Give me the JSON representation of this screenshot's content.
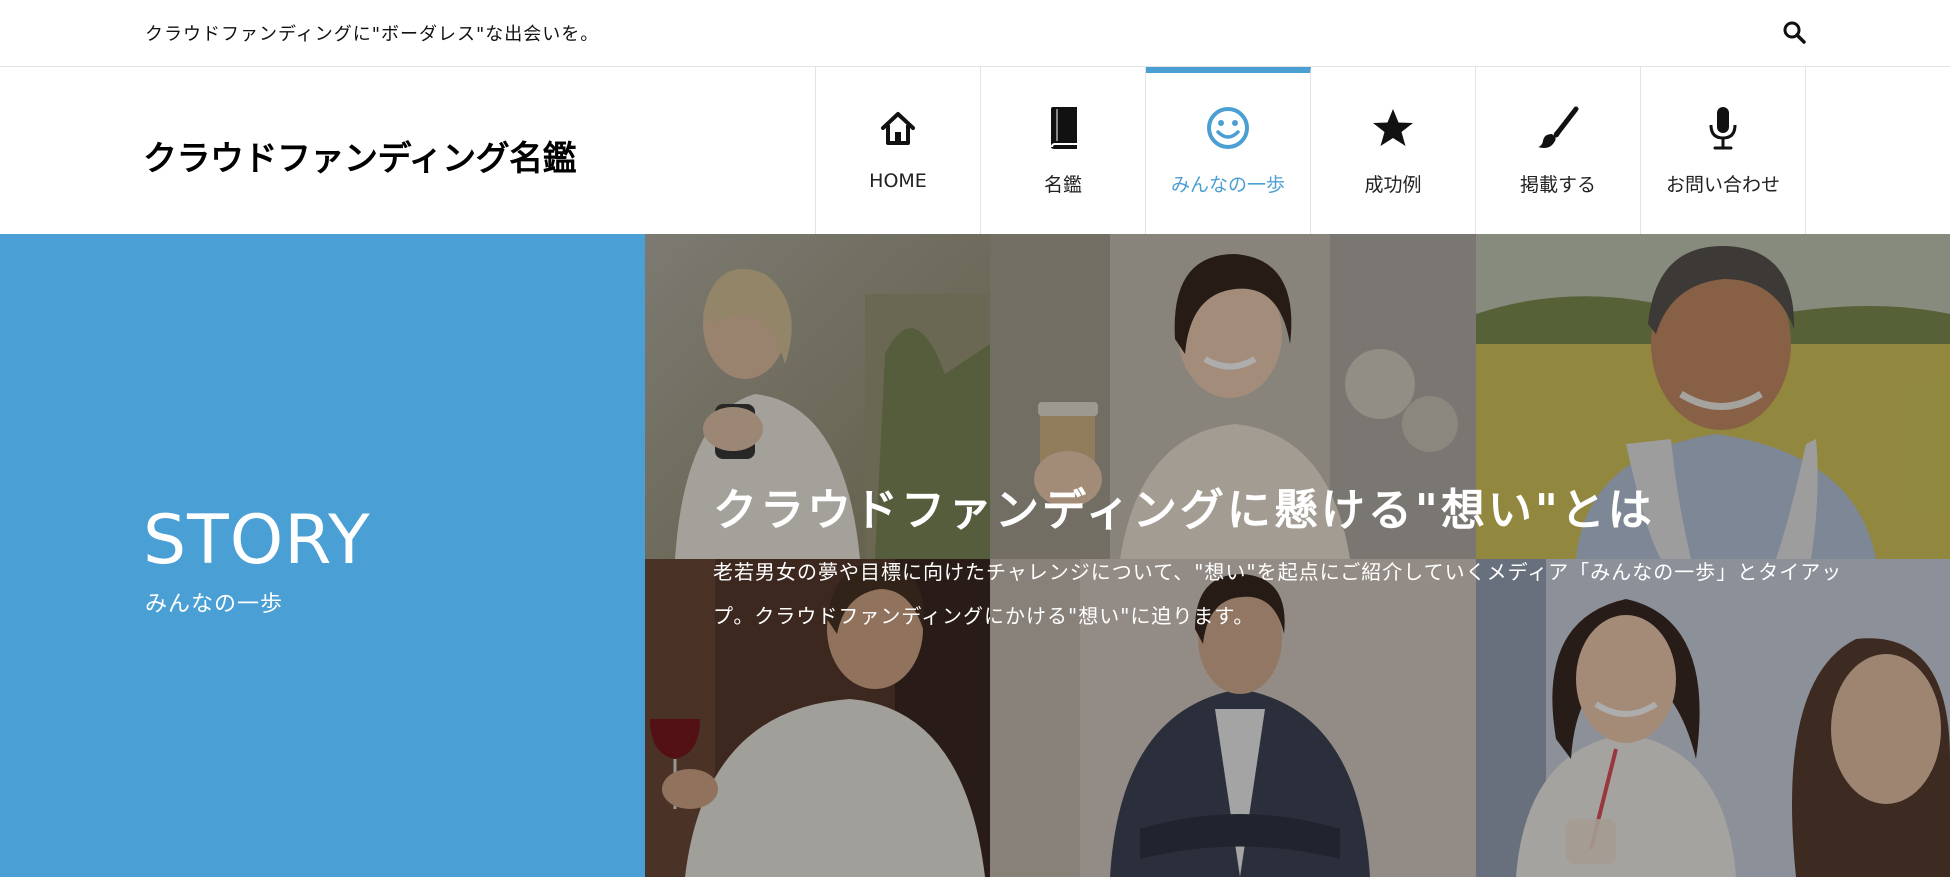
{
  "topbar": {
    "tagline": "クラウドファンディングに\"ボーダレス\"な出会いを。",
    "search_icon": "search-icon"
  },
  "header": {
    "site_title": "クラウドファンディング名鑑"
  },
  "nav": {
    "active_color": "#4b9fd3",
    "items": [
      {
        "label": "HOME",
        "icon": "home-icon"
      },
      {
        "label": "名鑑",
        "icon": "book-icon"
      },
      {
        "label": "みんなの一歩",
        "icon": "smile-icon"
      },
      {
        "label": "成功例",
        "icon": "star-icon"
      },
      {
        "label": "掲載する",
        "icon": "brush-icon"
      },
      {
        "label": "お問い合わせ",
        "icon": "microphone-icon"
      }
    ]
  },
  "hero": {
    "left_color": "#4a9fd5",
    "story_title": "STORY",
    "story_subtitle": "みんなの一歩",
    "title": "クラウドファンディングに懸ける\"想い\"とは",
    "description": "老若男女の夢や目標に向けたチャレンジについて、\"想い\"を起点にご紹介していくメディア「みんなの一歩」とタイアップ。クラウドファンディングにかける\"想い\"に迫ります。"
  }
}
